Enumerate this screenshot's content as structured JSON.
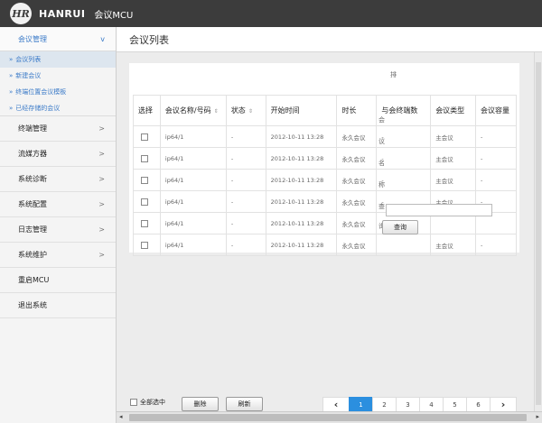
{
  "brand": {
    "logo": "HR",
    "name": "HANRUI",
    "title": "会议MCU"
  },
  "sidebar": {
    "section": {
      "label": "会议管理",
      "chevron": "v"
    },
    "subitems": [
      {
        "marker": "»",
        "label": "会议列表"
      },
      {
        "marker": "»",
        "label": "新建会议"
      },
      {
        "marker": "»",
        "label": "终端位置会议模板"
      },
      {
        "marker": "»",
        "label": "已经存储的会议"
      }
    ],
    "items": [
      {
        "label": "终端管理",
        "chevron": ">"
      },
      {
        "label": "流媒方器",
        "chevron": ">"
      },
      {
        "label": "系统诊断",
        "chevron": ">"
      },
      {
        "label": "系统配置",
        "chevron": ">"
      },
      {
        "label": "日志管理",
        "chevron": ">"
      },
      {
        "label": "系统维护",
        "chevron": ">"
      },
      {
        "label": "重启MCU",
        "chevron": ""
      },
      {
        "label": "退出系统",
        "chevron": ""
      }
    ]
  },
  "page": {
    "title": "会议列表"
  },
  "notes": {
    "top": "排",
    "c1": "会",
    "c2": "议",
    "c3": "名",
    "c4": "称",
    "c5": "查",
    "c6": "询:"
  },
  "table": {
    "headers": [
      "选择",
      "会议名称/号码",
      "状态",
      "开始时间",
      "时长",
      "与会终端数",
      "会议类型",
      "会议容量"
    ],
    "rows": [
      {
        "name": "ip64/1",
        "status": "-",
        "start": "2012-10-11 13:28",
        "duration": "永久会议",
        "count": "-",
        "type": "主会议",
        "capacity": "-"
      },
      {
        "name": "ip64/1",
        "status": "-",
        "start": "2012-10-11 13:28",
        "duration": "永久会议",
        "count": "-",
        "type": "主会议",
        "capacity": "-"
      },
      {
        "name": "ip64/1",
        "status": "-",
        "start": "2012-10-11 13:28",
        "duration": "永久会议",
        "count": "-",
        "type": "主会议",
        "capacity": "-"
      },
      {
        "name": "ip64/1",
        "status": "-",
        "start": "2012-10-11 13:28",
        "duration": "永久会议",
        "count": "-",
        "type": "主会议",
        "capacity": "-"
      },
      {
        "name": "ip64/1",
        "status": "-",
        "start": "2012-10-11 13:28",
        "duration": "永久会议",
        "count": "-",
        "type": "",
        "capacity": ""
      },
      {
        "name": "ip64/1",
        "status": "-",
        "start": "2012-10-11 13:28",
        "duration": "永久会议",
        "count": "",
        "type": "主会议",
        "capacity": "-"
      }
    ]
  },
  "search": {
    "value": "",
    "button": "查询"
  },
  "footer": {
    "select_all": "全部选中",
    "delete": "删除",
    "refresh": "刷新",
    "prev": "‹",
    "next": "›",
    "pages": [
      "1",
      "2",
      "3",
      "4",
      "5",
      "6"
    ],
    "current_page": "1"
  },
  "scroll": {
    "left": "◂",
    "right": "▸"
  }
}
